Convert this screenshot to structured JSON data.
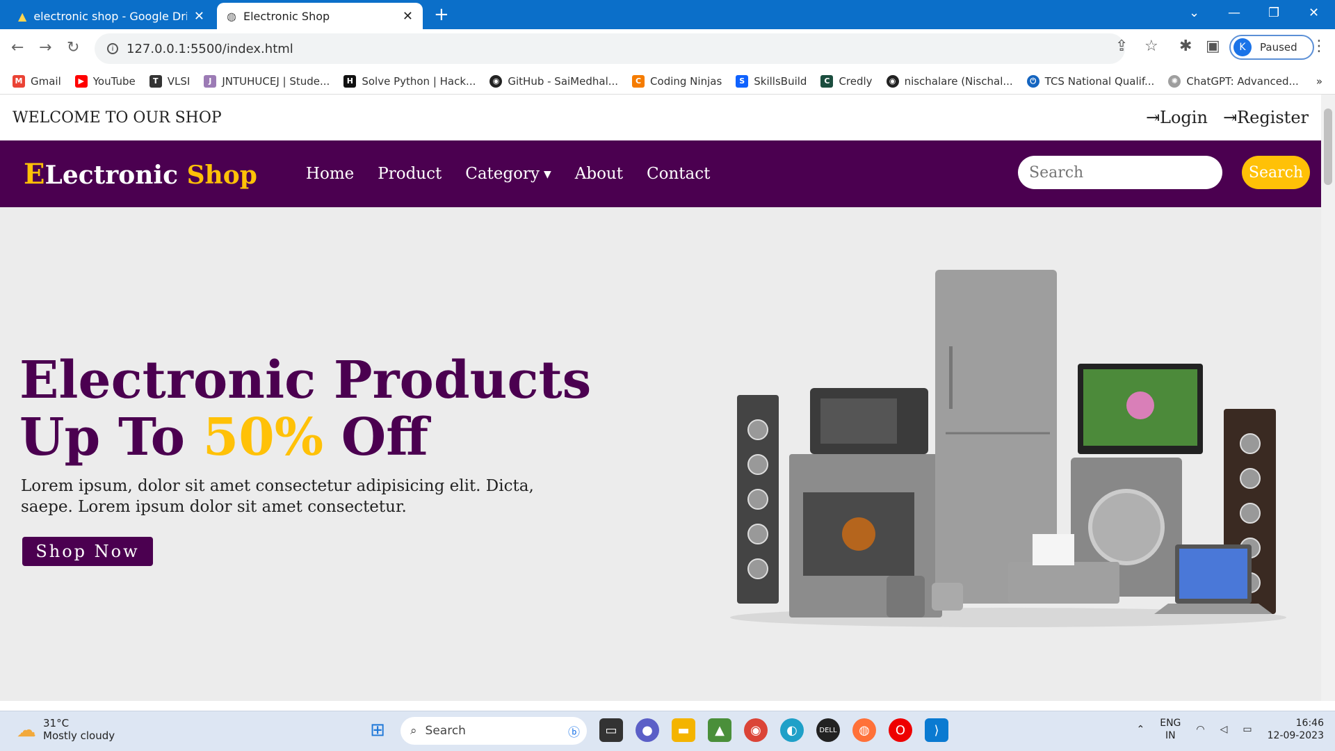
{
  "browser": {
    "tabs": [
      {
        "title": "electronic shop - Google Drive",
        "active": false
      },
      {
        "title": "Electronic Shop",
        "active": true
      }
    ],
    "url": "127.0.0.1:5500/index.html",
    "profile_initial": "K",
    "profile_status": "Paused",
    "bookmarks": [
      "Gmail",
      "YouTube",
      "VLSI",
      "JNTUHUCEJ | Stude...",
      "Solve Python | Hack...",
      "GitHub - SaiMedhal...",
      "Coding Ninjas",
      "SkillsBuild",
      "Credly",
      "nischalare (Nischal...",
      "TCS National Qualif...",
      "ChatGPT: Advanced..."
    ]
  },
  "shop": {
    "welcome": "WELCOME TO OUR SHOP",
    "login": "Login",
    "register": "Register",
    "logo_first": "E",
    "logo_rest": "Lectronic",
    "logo_shop": "Shop",
    "menu": [
      "Home",
      "Product",
      "Category",
      "About",
      "Contact"
    ],
    "search_placeholder": "Search",
    "search_button": "Search",
    "hero_line1": "Electronic Products",
    "hero_line2_a": "Up To ",
    "hero_line2_pct": "50%",
    "hero_line2_b": " Off",
    "hero_text": "Lorem ipsum, dolor sit amet consectetur adipisicing elit. Dicta, saepe. Lorem ipsum dolor sit amet consectetur.",
    "shop_now": "Shop Now"
  },
  "taskbar": {
    "temp": "31°C",
    "weather": "Mostly cloudy",
    "search": "Search",
    "lang1": "ENG",
    "lang2": "IN",
    "time": "16:46",
    "date": "12-09-2023"
  },
  "colors": {
    "brand_purple": "#4b0050",
    "accent_yellow": "#ffc107",
    "fab_orange": "#ff7a00"
  }
}
